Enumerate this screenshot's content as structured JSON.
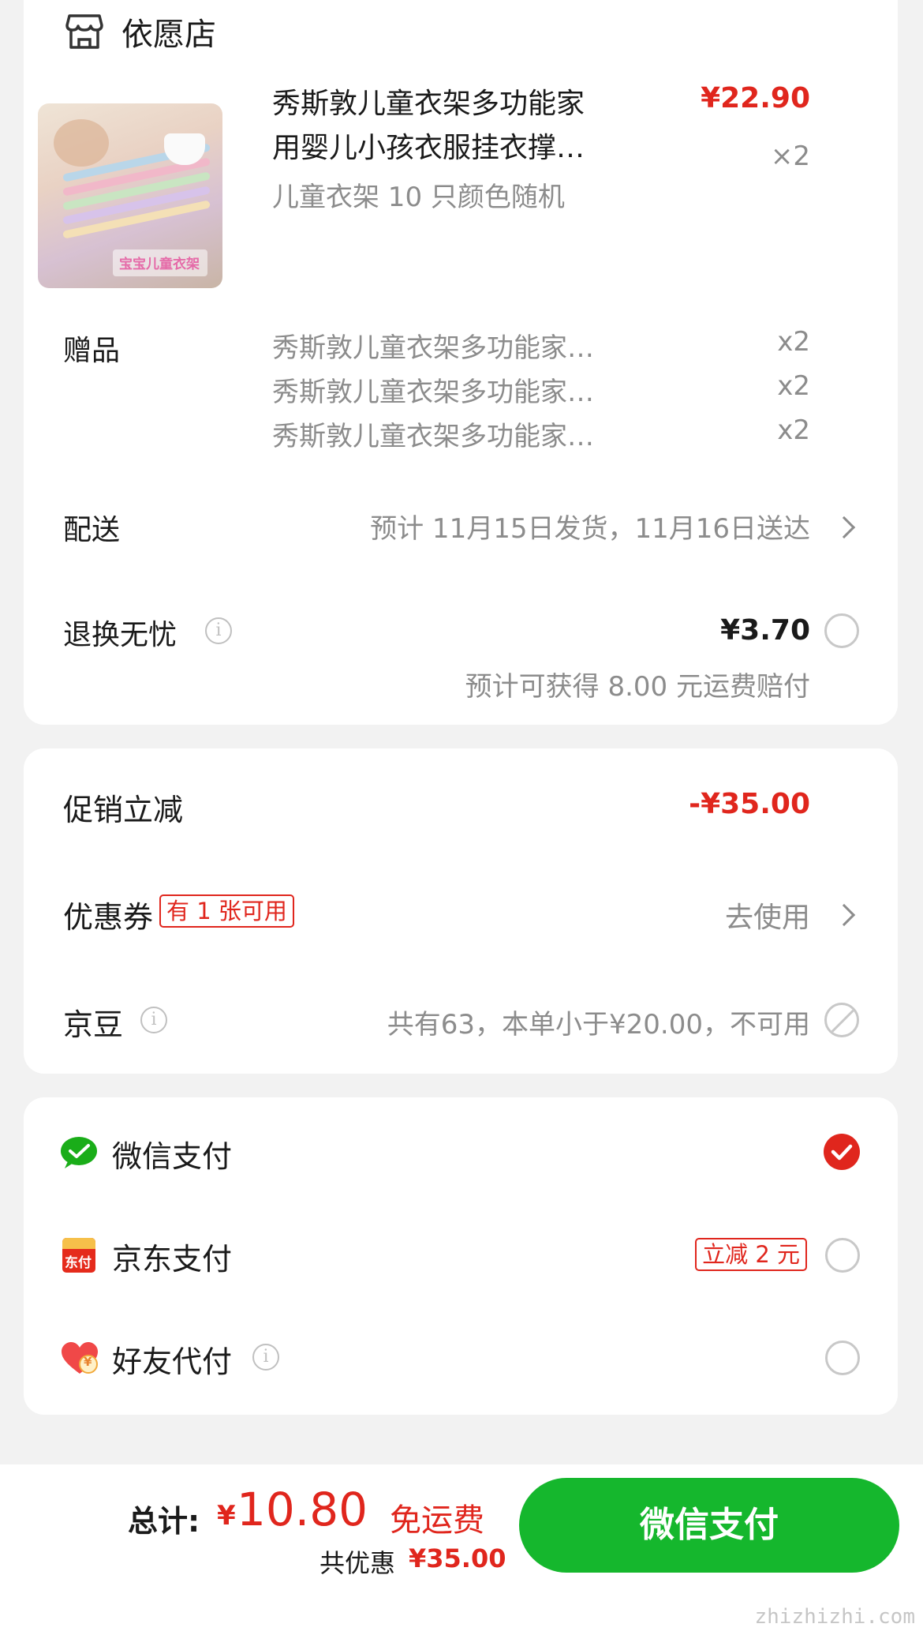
{
  "store": {
    "name": "依愿店",
    "icon": "store-icon"
  },
  "product": {
    "title_line1": "秀斯敦儿童衣架多功能家",
    "title_line2": "用婴儿小孩衣服挂衣撑…",
    "spec": "儿童衣架 10 只颜色随机",
    "price": "¥22.90",
    "qty": "×2",
    "thumb_text": "宝宝儿童衣架"
  },
  "gifts": {
    "label": "赠品",
    "items": [
      {
        "name": "秀斯敦儿童衣架多功能家…",
        "qty": "x2"
      },
      {
        "name": "秀斯敦儿童衣架多功能家…",
        "qty": "x2"
      },
      {
        "name": "秀斯敦儿童衣架多功能家…",
        "qty": "x2"
      }
    ]
  },
  "delivery": {
    "label": "配送",
    "value": "预计 11月15日发货，11月16日送达"
  },
  "return_insurance": {
    "label": "退换无忧",
    "price": "¥3.70",
    "note": "预计可获得 8.00 元运费赔付"
  },
  "promotion": {
    "label": "促销立减",
    "value": "-¥35.00"
  },
  "coupon": {
    "label": "优惠券",
    "badge": "有 1 张可用",
    "action": "去使用"
  },
  "jingdou": {
    "label": "京豆",
    "value": "共有63，本单小于¥20.00，不可用"
  },
  "payment": {
    "wechat": {
      "label": "微信支付",
      "selected": true
    },
    "jd": {
      "label": "京东支付",
      "icon_text": "东付",
      "badge": "立减 2 元"
    },
    "friend": {
      "label": "好友代付",
      "icon_text": "¥"
    }
  },
  "footer": {
    "total_label": "总计:",
    "currency": "¥",
    "total": "10.80",
    "shipping": "免运费",
    "discount_label": "共优惠",
    "discount": "¥35.00",
    "pay_button": "微信支付"
  },
  "watermark": "zhizhizhi.com",
  "colors": {
    "accent_red": "#e0261d",
    "wechat_green": "#15b72d"
  }
}
